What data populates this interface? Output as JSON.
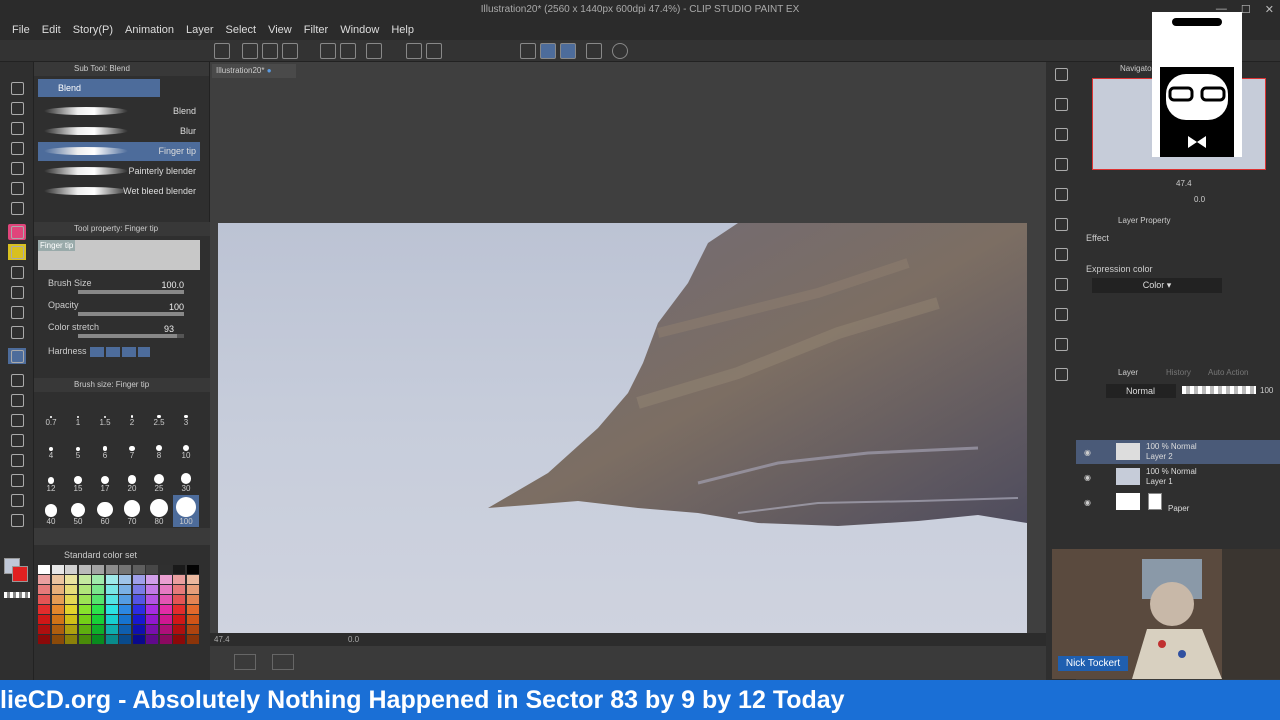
{
  "window": {
    "title": "Illustration20* (2560 x 1440px 600dpi 47.4%) - CLIP STUDIO PAINT EX",
    "controls": [
      "—",
      "☐",
      "✕"
    ]
  },
  "menu": [
    "File",
    "Edit",
    "Story(P)",
    "Animation",
    "Layer",
    "Select",
    "View",
    "Filter",
    "Window",
    "Help"
  ],
  "subtool": {
    "header": "Sub Tool: Blend",
    "group": "Blend",
    "brushes": [
      "Blend",
      "Blur",
      "Finger tip",
      "Painterly blender",
      "Wet bleed blender"
    ],
    "selected_index": 2
  },
  "toolprop": {
    "header": "Tool property: Finger tip",
    "preview_label": "Finger tip",
    "brush_size_label": "Brush Size",
    "brush_size_value": "100.0",
    "opacity_label": "Opacity",
    "opacity_value": "100",
    "color_stretch_label": "Color stretch",
    "color_stretch_value": "93",
    "hardness_label": "Hardness"
  },
  "brushsize": {
    "header": "Brush size: Finger tip",
    "sizes": [
      "0.7",
      "1",
      "1.5",
      "2",
      "2.5",
      "3",
      "4",
      "5",
      "6",
      "7",
      "8",
      "10",
      "12",
      "15",
      "17",
      "20",
      "25",
      "30",
      "40",
      "50",
      "60",
      "70",
      "80",
      "100"
    ],
    "selected": "100"
  },
  "colorset": {
    "header": "Standard color set"
  },
  "document": {
    "tab": "Illustration20*",
    "zoom": "47.4",
    "angle": "0.0"
  },
  "navigator": {
    "header": "Navigator",
    "zoom": "47.4",
    "angle": "0.0"
  },
  "layerprop": {
    "header": "Layer Property",
    "effect_label": "Effect",
    "expression_label": "Expression color",
    "expression_value": "Color"
  },
  "layers": {
    "tabs": [
      "Layer",
      "History",
      "Auto Action"
    ],
    "blend_mode": "Normal",
    "opacity": "100",
    "items": [
      {
        "mode": "100 % Normal",
        "name": "Layer 2",
        "selected": true
      },
      {
        "mode": "100 % Normal",
        "name": "Layer 1",
        "selected": false
      },
      {
        "mode": "",
        "name": "Paper",
        "selected": false
      }
    ]
  },
  "webcam": {
    "name": "Nick Tockert"
  },
  "ticker": {
    "text": "lieCD.org - Absolutely Nothing Happened in Sector 83 by 9 by 12 Today"
  },
  "colors": {
    "accent": "#4d6c9b",
    "ticker_bg": "#1a6fd6",
    "tool_active": "#e0457b",
    "nametag": "#1f5fb0"
  }
}
